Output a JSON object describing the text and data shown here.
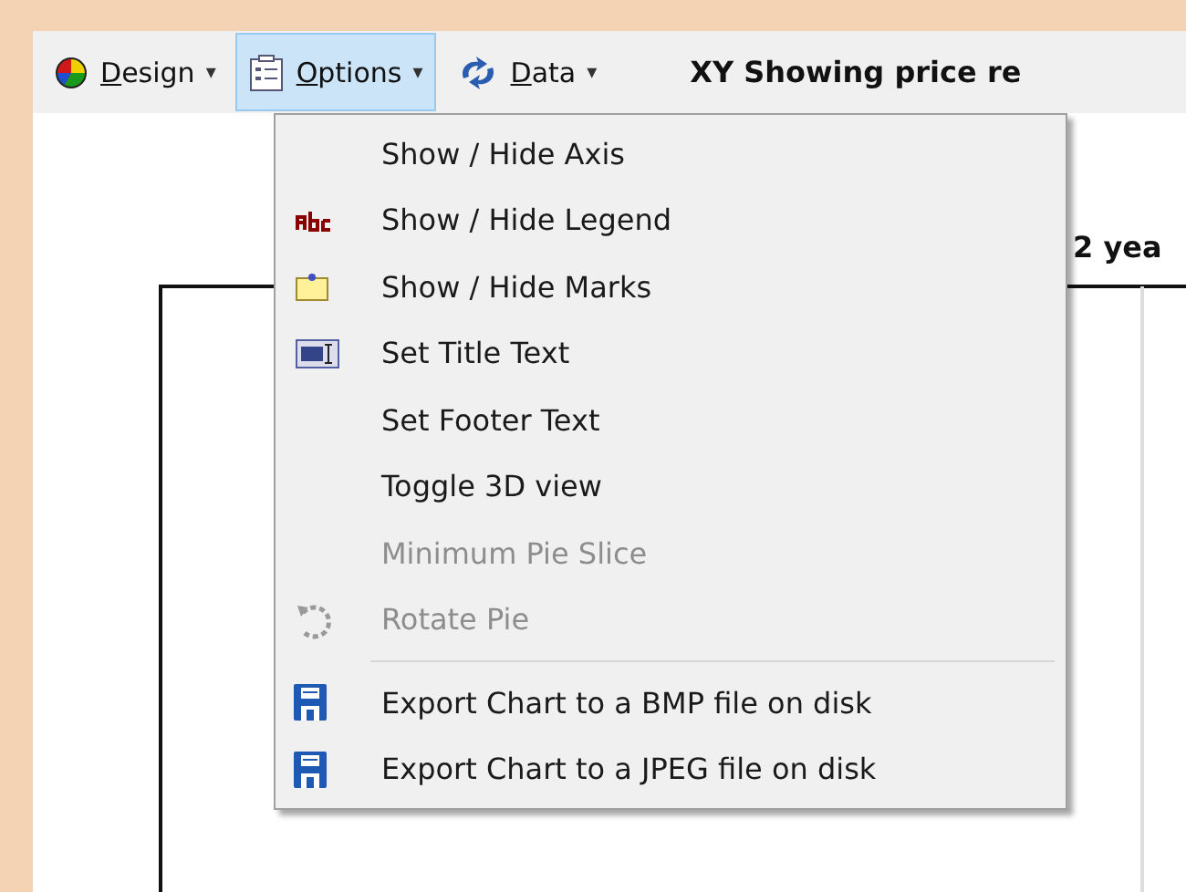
{
  "toolbar": {
    "buttons": [
      {
        "label": "Design",
        "caret": "▾",
        "selected": false
      },
      {
        "label": "Options",
        "caret": "▾",
        "selected": true
      },
      {
        "label": "Data",
        "caret": "▾",
        "selected": false
      }
    ],
    "title": "XY Showing price re"
  },
  "chart": {
    "title": "2 yea"
  },
  "menu": {
    "items": [
      {
        "kind": "item",
        "label": "Show / Hide Axis",
        "disabled": false
      },
      {
        "kind": "item",
        "label": "Show / Hide Legend",
        "disabled": false
      },
      {
        "kind": "item",
        "label": "Show / Hide Marks",
        "disabled": false
      },
      {
        "kind": "item",
        "label": "Set Title Text",
        "disabled": false
      },
      {
        "kind": "item",
        "label": "Set Footer Text",
        "disabled": false
      },
      {
        "kind": "item",
        "label": "Toggle 3D view",
        "disabled": false
      },
      {
        "kind": "item",
        "label": "Minimum Pie Slice",
        "disabled": true
      },
      {
        "kind": "item",
        "label": "Rotate Pie",
        "disabled": true
      },
      {
        "kind": "separator"
      },
      {
        "kind": "item",
        "label": "Export Chart to a BMP file on disk",
        "disabled": false
      },
      {
        "kind": "item",
        "label": "Export Chart to a JPEG file on disk",
        "disabled": false
      }
    ]
  }
}
